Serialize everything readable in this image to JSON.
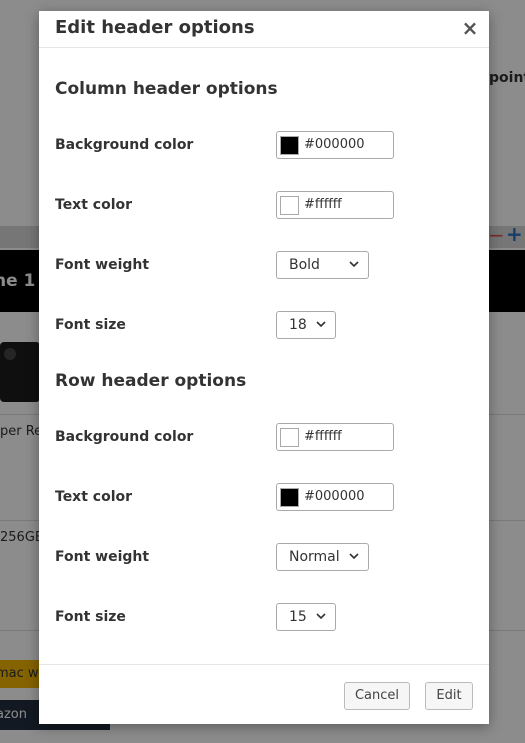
{
  "background": {
    "header_fragment": "ne 1",
    "text_fragment_1": "per Re",
    "text_fragment_2": "256GE",
    "text_fragment_3": "point",
    "button_fragment_1": "mac w",
    "button_fragment_2": "azon",
    "toolbar_minus": "−",
    "toolbar_plus": "+"
  },
  "modal": {
    "title": "Edit header options",
    "close_glyph": "×",
    "column_section": {
      "title": "Column header options",
      "background_color": {
        "label": "Background color",
        "value": "#000000",
        "swatch": "#000000"
      },
      "text_color": {
        "label": "Text color",
        "value": "#ffffff",
        "swatch": "#ffffff"
      },
      "font_weight": {
        "label": "Font weight",
        "value": "Bold"
      },
      "font_size": {
        "label": "Font size",
        "value": "18"
      }
    },
    "row_section": {
      "title": "Row header options",
      "background_color": {
        "label": "Background color",
        "value": "#ffffff",
        "swatch": "#ffffff"
      },
      "text_color": {
        "label": "Text color",
        "value": "#000000",
        "swatch": "#000000"
      },
      "font_weight": {
        "label": "Font weight",
        "value": "Normal"
      },
      "font_size": {
        "label": "Font size",
        "value": "15"
      }
    },
    "footer": {
      "cancel_label": "Cancel",
      "edit_label": "Edit"
    }
  }
}
